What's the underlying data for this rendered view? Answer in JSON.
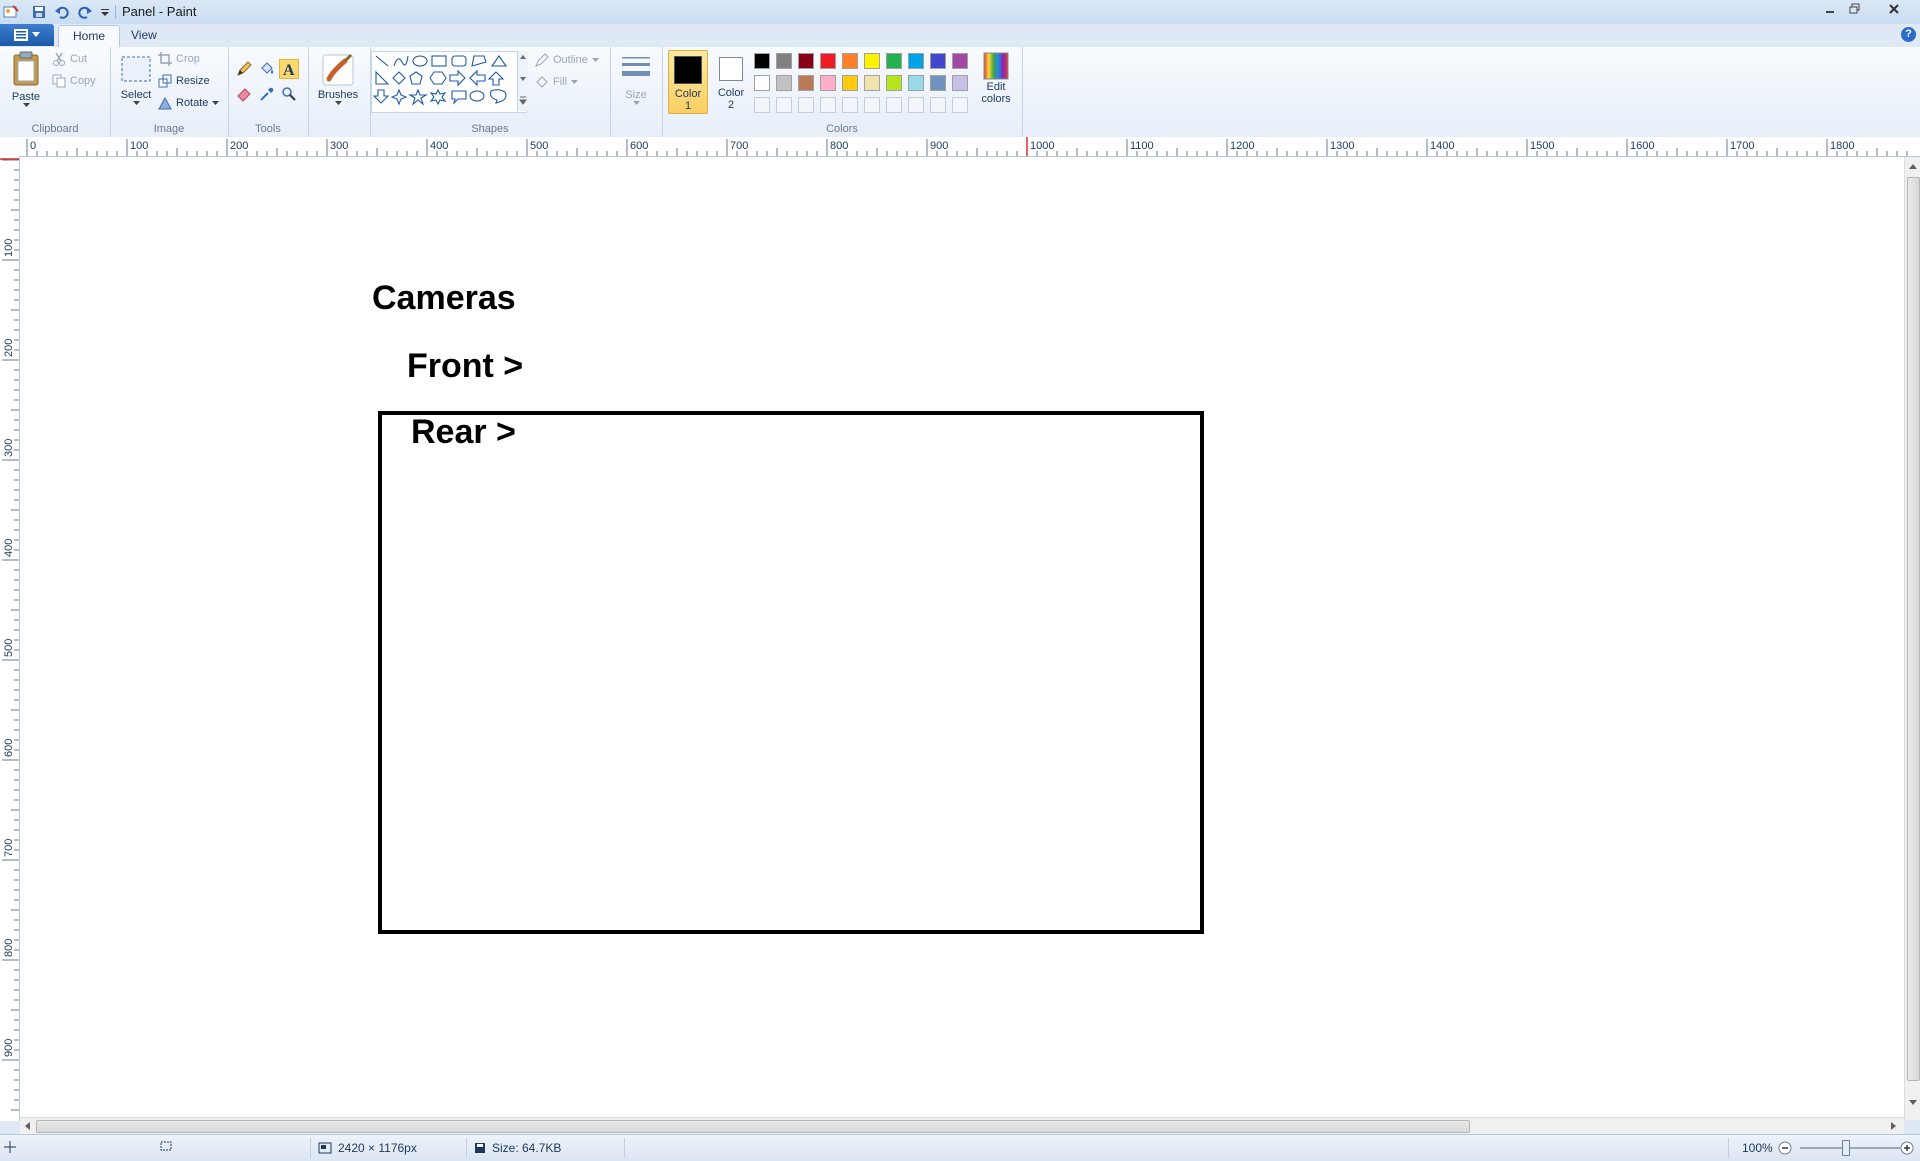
{
  "window": {
    "title": "Panel - Paint",
    "controls": [
      "minimize-icon",
      "restore-icon",
      "close-icon"
    ]
  },
  "quick_access": [
    "save-icon",
    "undo-icon",
    "redo-icon",
    "customize-arrow-icon"
  ],
  "tabs": [
    {
      "label": "Home",
      "active": true
    },
    {
      "label": "View",
      "active": false
    }
  ],
  "ribbon": {
    "clipboard": {
      "label": "Clipboard",
      "paste": "Paste",
      "cut": "Cut",
      "copy": "Copy"
    },
    "image": {
      "label": "Image",
      "select": "Select",
      "crop": "Crop",
      "resize": "Resize",
      "rotate": "Rotate"
    },
    "tools": {
      "label": "Tools",
      "active_tool": "text"
    },
    "brushes": {
      "label": "Brushes"
    },
    "shapes": {
      "label": "Shapes",
      "outline": "Outline",
      "fill": "Fill"
    },
    "size": {
      "label": "Size"
    },
    "colors": {
      "label": "Colors",
      "color1_label": "Color",
      "color1_num": "1",
      "color2_label": "Color",
      "color2_num": "2",
      "color1": "#000000",
      "color2": "#ffffff",
      "edit_colors_line1": "Edit",
      "edit_colors_line2": "colors",
      "palette_row1": [
        "#000000",
        "#7f7f7f",
        "#880015",
        "#ed1c24",
        "#ff7f27",
        "#fff200",
        "#22b14c",
        "#00a2e8",
        "#3f48cc",
        "#a349a4"
      ],
      "palette_row2": [
        "#ffffff",
        "#c3c3c3",
        "#b97a57",
        "#ffaec9",
        "#ffc90e",
        "#efe4b0",
        "#b5e61d",
        "#99d9ea",
        "#7092be",
        "#c8bfe7"
      ]
    }
  },
  "ruler": {
    "h_labels": [
      "0",
      "100",
      "200",
      "300",
      "400",
      "500",
      "600",
      "700",
      "800",
      "900",
      "1000",
      "1100",
      "1200",
      "1300",
      "1400",
      "1500",
      "1600",
      "1700",
      "1800"
    ],
    "v_labels": [
      "100",
      "200",
      "300",
      "400",
      "500",
      "600",
      "700",
      "800",
      "900"
    ]
  },
  "canvas": {
    "heading": "Cameras",
    "item1": "Front >",
    "item2": "Rear >"
  },
  "status": {
    "dimensions": "2420 × 1176px",
    "size": "Size: 64.7KB",
    "zoom": "100%"
  }
}
